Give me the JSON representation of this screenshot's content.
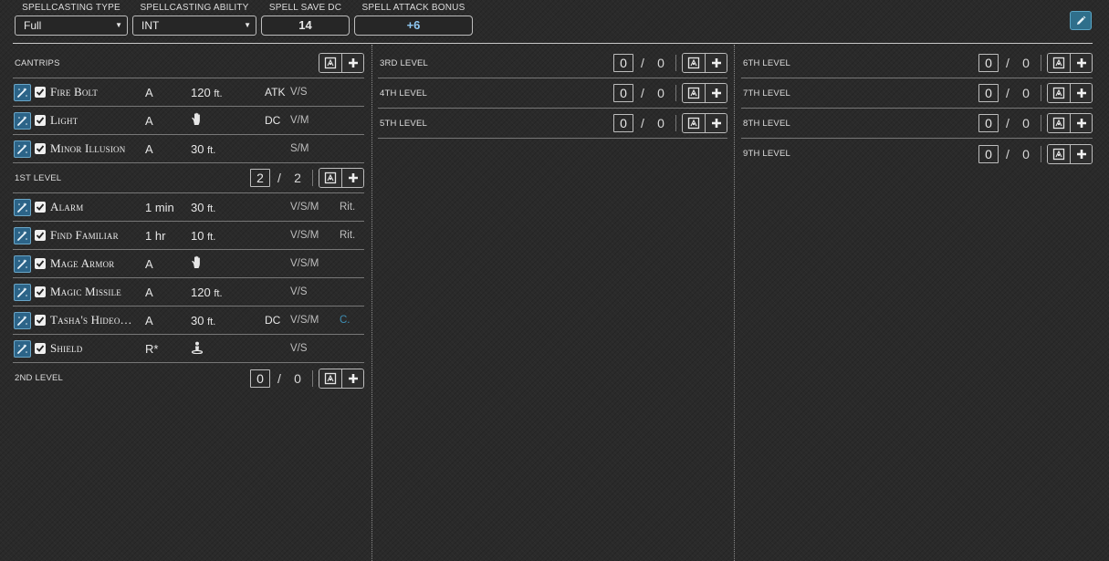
{
  "header": {
    "spellcasting_type": {
      "label": "SPELLCASTING TYPE",
      "value": "Full"
    },
    "spellcasting_ability": {
      "label": "SPELLCASTING ABILITY",
      "value": "INT"
    },
    "spell_save_dc": {
      "label": "SPELL SAVE DC",
      "value": "14"
    },
    "spell_attack_bonus": {
      "label": "SPELL ATTACK BONUS",
      "value": "+6"
    },
    "edit_icon": "pencil-icon"
  },
  "colors": {
    "accent": "#2c6488",
    "attack_bonus": "#8fc8f2",
    "concentration": "#3f8fb5"
  },
  "cantrips": {
    "label": "CANTRIPS",
    "spells": [
      {
        "name": "Fire Bolt",
        "time": "A",
        "range": "120",
        "range_unit": "ft.",
        "attack": "ATK",
        "components": "V/S",
        "tag": ""
      },
      {
        "name": "Light",
        "time": "A",
        "range_icon": "touch-hand-icon",
        "attack": "DC",
        "components": "V/M",
        "tag": ""
      },
      {
        "name": "Minor Illusion",
        "time": "A",
        "range": "30",
        "range_unit": "ft.",
        "attack": "",
        "components": "S/M",
        "tag": ""
      }
    ]
  },
  "level1": {
    "label": "1ST LEVEL",
    "current": "2",
    "sep": "/",
    "max": "2",
    "spells": [
      {
        "name": "Alarm",
        "time": "1 min",
        "range": "30",
        "range_unit": "ft.",
        "attack": "",
        "components": "V/S/M",
        "tag": "Rit."
      },
      {
        "name": "Find Familiar",
        "time": "1 hr",
        "range": "10",
        "range_unit": "ft.",
        "attack": "",
        "components": "V/S/M",
        "tag": "Rit."
      },
      {
        "name": "Mage Armor",
        "time": "A",
        "range_icon": "touch-hand-icon",
        "attack": "",
        "components": "V/S/M",
        "tag": ""
      },
      {
        "name": "Magic Missile",
        "time": "A",
        "range": "120",
        "range_unit": "ft.",
        "attack": "",
        "components": "V/S",
        "tag": ""
      },
      {
        "name": "Tasha's Hideo…",
        "time": "A",
        "range": "30",
        "range_unit": "ft.",
        "attack": "DC",
        "components": "V/S/M",
        "tag": "C."
      },
      {
        "name": "Shield",
        "time": "R*",
        "range_icon": "self-person-icon",
        "attack": "",
        "components": "V/S",
        "tag": ""
      }
    ]
  },
  "level2": {
    "label": "2ND LEVEL",
    "current": "0",
    "sep": "/",
    "max": "0"
  },
  "level3": {
    "label": "3RD LEVEL",
    "current": "0",
    "sep": "/",
    "max": "0"
  },
  "level4": {
    "label": "4TH LEVEL",
    "current": "0",
    "sep": "/",
    "max": "0"
  },
  "level5": {
    "label": "5TH LEVEL",
    "current": "0",
    "sep": "/",
    "max": "0"
  },
  "level6": {
    "label": "6TH LEVEL",
    "current": "0",
    "sep": "/",
    "max": "0"
  },
  "level7": {
    "label": "7TH LEVEL",
    "current": "0",
    "sep": "/",
    "max": "0"
  },
  "level8": {
    "label": "8TH LEVEL",
    "current": "0",
    "sep": "/",
    "max": "0"
  },
  "level9": {
    "label": "9TH LEVEL",
    "current": "0",
    "sep": "/",
    "max": "0"
  }
}
